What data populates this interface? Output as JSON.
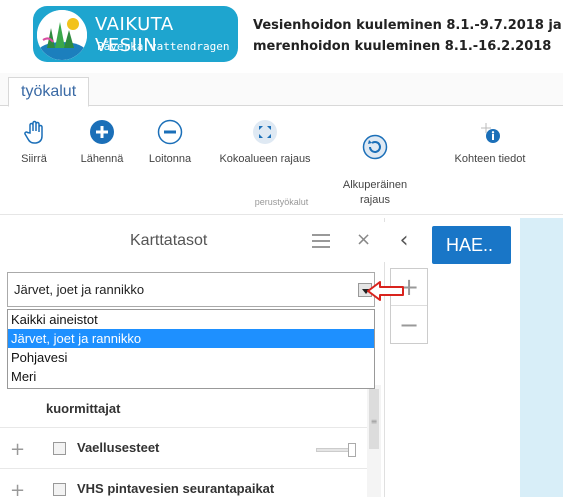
{
  "header": {
    "logo_title": "VAIKUTA VESIIN",
    "logo_subtitle": "Påverka vattendragen",
    "line1": "Vesienhoidon kuuleminen 8.1.-9.7.2018 ja",
    "line2": "merenhoidon kuuleminen 8.1.-16.2.2018"
  },
  "tabs": [
    {
      "label": "työkalut"
    }
  ],
  "toolbar": {
    "group_label": "perustyökalut",
    "tools": [
      {
        "label": "Siirrä",
        "icon": "hand-icon"
      },
      {
        "label": "Lähennä",
        "icon": "zoom-in-icon"
      },
      {
        "label": "Loitonna",
        "icon": "zoom-out-icon"
      },
      {
        "label": "Kokoalueen rajaus",
        "icon": "fullscreen-icon"
      },
      {
        "label": "Alkuperäinen\nrajaus",
        "icon": "reset-icon"
      },
      {
        "label": "Kohteen tiedot",
        "icon": "info-icon"
      }
    ]
  },
  "panel": {
    "title": "Karttatasot",
    "select_value": "Järvet, joet ja rannikko",
    "dropdown_options": [
      "Kaikki aineistot",
      "Järvet, joet ja rannikko",
      "Pohjavesi",
      "Meri"
    ],
    "selected_index": 1,
    "partial_label": "kuormittajat",
    "layers": [
      {
        "label": "Vaellusesteet"
      },
      {
        "label": "VHS pintavesien seurantapaikat"
      }
    ]
  },
  "search_button": "HAE..",
  "colors": {
    "logo_bg": "#1ea5cf",
    "accent_blue": "#1976c7",
    "tab_text": "#3a6aa5",
    "dropdown_selected": "#1e90ff",
    "tool_icon": "#1b6fb8",
    "annotation_arrow": "#d9231d",
    "map_bg": "#d8eef8"
  }
}
